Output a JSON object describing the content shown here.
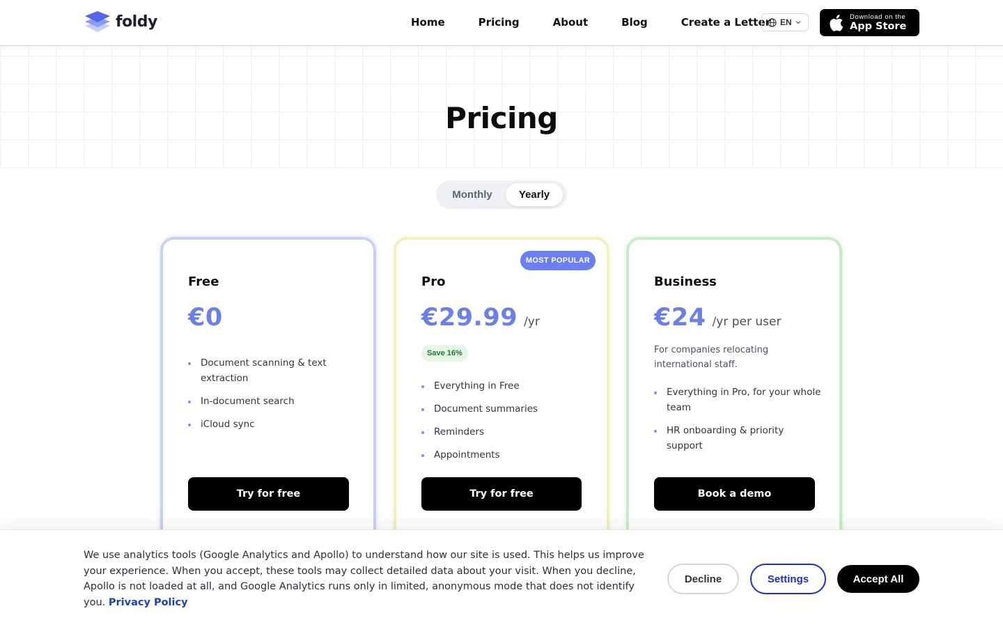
{
  "header": {
    "logo_text": "foldy",
    "nav": [
      "Home",
      "Pricing",
      "About",
      "Blog",
      "Create a Letter"
    ],
    "language": "EN",
    "appstore": {
      "small": "Download on the",
      "big": "App Store"
    }
  },
  "page_title": "Pricing",
  "billing_toggle": {
    "monthly": "Monthly",
    "yearly": "Yearly",
    "selected": "Yearly"
  },
  "plans": [
    {
      "name": "Free",
      "price": "€0",
      "period": "",
      "features": [
        "Document scanning & text extraction",
        "In-document search",
        "iCloud sync"
      ],
      "cta": "Try for free"
    },
    {
      "name": "Pro",
      "badge": "MOST POPULAR",
      "price": "€29.99",
      "period": "/yr",
      "save": "Save 16%",
      "features": [
        "Everything in Free",
        "Document summaries",
        "Reminders",
        "Appointments"
      ],
      "cta": "Try for free"
    },
    {
      "name": "Business",
      "price": "€24",
      "period": "/yr per user",
      "description": "For companies relocating international staff.",
      "features": [
        "Everything in Pro, for your whole team",
        "HR onboarding & priority support"
      ],
      "cta": "Book a demo"
    }
  ],
  "cookie": {
    "text": "We use analytics tools (Google Analytics and Apollo) to understand how our site is used. This helps us improve your experience. When you accept, these tools may collect detailed data about your visit. When you decline, Apollo is not loaded at all, and Google Analytics runs only in limited, anonymous mode that does not identify you.",
    "link": "Privacy Policy",
    "decline": "Decline",
    "settings": "Settings",
    "accept": "Accept All"
  },
  "colors": {
    "accent": "#6b7fe8",
    "badge": "#6a7ff0",
    "settings_border": "#1e2ec9",
    "save_bg": "#e5f6e6",
    "save_text": "#1f7a2c"
  }
}
